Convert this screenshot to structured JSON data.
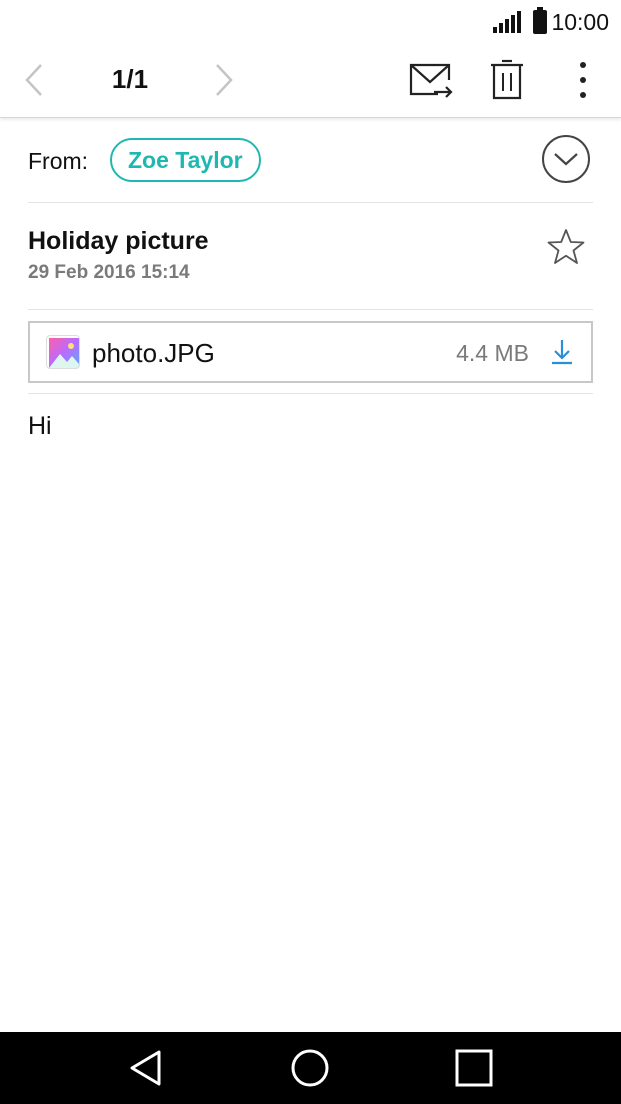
{
  "status_bar": {
    "time": "10:00"
  },
  "toolbar": {
    "page_count": "1/1"
  },
  "message": {
    "from_label": "From:",
    "sender": "Zoe Taylor",
    "subject": "Holiday picture",
    "date": "29 Feb 2016 15:14",
    "body": "Hi"
  },
  "attachment": {
    "file_name": "photo.JPG",
    "file_size": "4.4 MB"
  },
  "colors": {
    "accent": "#1fb8b0",
    "download": "#2a8fd6"
  },
  "icons": [
    "signal-icon",
    "battery-icon",
    "chevron-left-icon",
    "chevron-right-icon",
    "forward-mail-icon",
    "delete-icon",
    "more-vert-icon",
    "chevron-down-icon",
    "star-icon",
    "image-file-icon",
    "download-icon",
    "back-triangle-icon",
    "home-circle-icon",
    "recent-square-icon"
  ]
}
